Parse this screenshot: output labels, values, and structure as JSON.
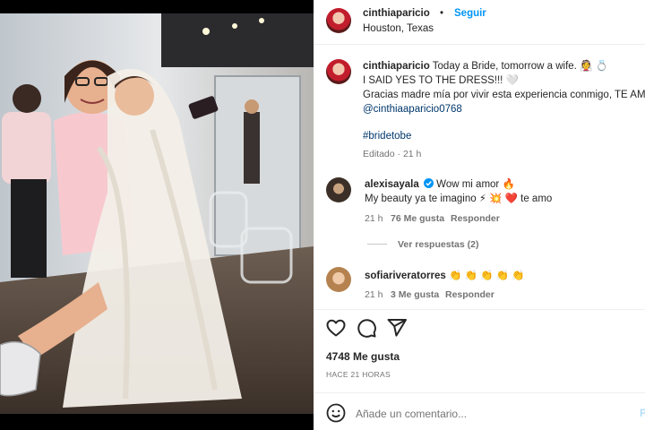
{
  "post": {
    "username": "cinthiaparicio",
    "follow_label": "Seguir",
    "dot": "•",
    "location": "Houston, Texas"
  },
  "caption": {
    "username": "cinthiaparicio",
    "line1": "Today a Bride, tomorrow a wife. 👰 💍",
    "line2": "I SAID YES TO THE DRESS!!! 🤍",
    "line3": "Gracias madre mía por vivir esta experiencia conmigo, TE AMO",
    "mention": "@cinthiaaparicio0768",
    "hashtag": "#bridetobe",
    "meta": "Editado · 21 h"
  },
  "comments": [
    {
      "username": "alexisayala",
      "verified": true,
      "text_line1": "Wow mi amor 🔥",
      "text_line2": "My beauty ya te imagino ⚡ 💥 ❤️ te amo",
      "time": "21 h",
      "likes": "76 Me gusta",
      "reply": "Responder",
      "view_replies": "Ver respuestas (2)"
    },
    {
      "username": "sofiariveratorres",
      "text": "👏 👏 👏 👏 👏",
      "time": "21 h",
      "likes": "3 Me gusta",
      "reply": "Responder"
    }
  ],
  "actions": {
    "like_icon": "heart-icon",
    "comment_icon": "comment-icon",
    "share_icon": "share-icon"
  },
  "likes_count": "4748 Me gusta",
  "timestamp": "HACE 21 HORAS",
  "add_comment": {
    "placeholder": "Añade un comentario...",
    "emoji_icon": "emoji-icon",
    "publish_label": "P"
  },
  "colors": {
    "accent": "#0095f6",
    "verified": "#0095f6",
    "muted": "#737373",
    "link": "#00376b"
  }
}
